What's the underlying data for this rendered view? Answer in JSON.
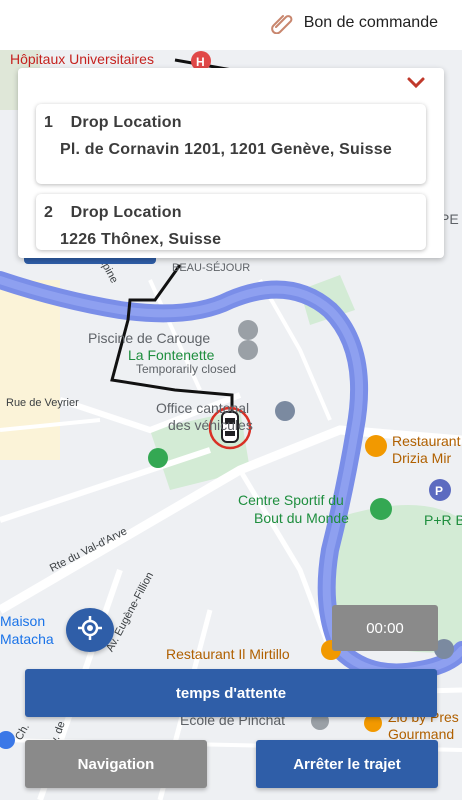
{
  "header": {
    "order_label": "Bon de commande"
  },
  "locations": [
    {
      "index": "1",
      "title": "Drop Location",
      "address": "Pl. de Cornavin 1201, 1201 Genève, Suisse"
    },
    {
      "index": "2",
      "title": "Drop Location",
      "address": "1226 Thônex, Suisse"
    }
  ],
  "map": {
    "labels": {
      "hospitals": "Hôpitaux Universitaires",
      "beau_sejour": "BEAU-SÉJOUR",
      "piscine": "Piscine de Carouge",
      "fontenette": "La Fontenette",
      "temp_closed": "Temporarily closed",
      "office_1": "Office cantonal",
      "office_2": "des véhicules",
      "rue_veyrier": "Rue de Veyrier",
      "centre_sportif_1": "Centre Sportif du",
      "centre_sportif_2": "Bout du Monde",
      "restaurant_drizia_1": "Restaurant",
      "restaurant_drizia_2": "Drizia Mir",
      "pr": "P+R B",
      "rte_val_arve": "Rte du Val-d'Arve",
      "fillion": "Av. Eugène-Fillion",
      "maison_1": "Maison",
      "maison_2": "Matacha",
      "mirtillo": "Restaurant Il Mirtillo",
      "ecole": "École de Pinchat",
      "zio_1": "Zio by Pres",
      "zio_2": "Gourmand",
      "pe": "PE",
      "epine": "Épine",
      "ch": "Ch.",
      "av": "Av. de"
    }
  },
  "controls": {
    "timer": "00:00",
    "wait_button": "temps d'attente",
    "navigation_button": "Navigation",
    "stop_button": "Arrêter le trajet"
  },
  "colors": {
    "primary": "#2f5ea8",
    "secondary": "#8a8a8a",
    "river": "#7a8ee8",
    "park": "#d3ebd5",
    "chevron": "#c0392b"
  }
}
